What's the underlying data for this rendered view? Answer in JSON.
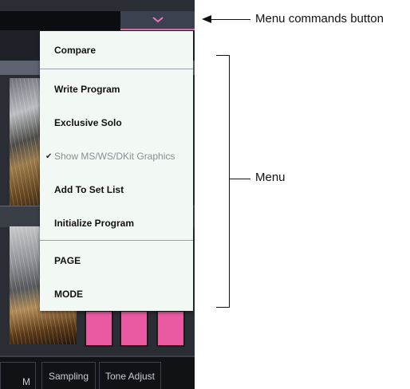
{
  "menu_button": {
    "icon": "chevron-down-icon"
  },
  "menu": {
    "items": [
      {
        "label": "Compare",
        "enabled": true,
        "checked": false
      },
      {
        "label": "Write Program",
        "enabled": true,
        "checked": false
      },
      {
        "label": "Exclusive Solo",
        "enabled": true,
        "checked": false
      },
      {
        "label": "Show MS/WS/DKit Graphics",
        "enabled": false,
        "checked": true
      },
      {
        "label": "Add To Set List",
        "enabled": true,
        "checked": false
      },
      {
        "label": "Initialize Program",
        "enabled": true,
        "checked": false
      },
      {
        "label": "PAGE",
        "enabled": true,
        "checked": false
      },
      {
        "label": "MODE",
        "enabled": true,
        "checked": false
      }
    ],
    "check_mark": "✔"
  },
  "bottom_tabs": [
    "M",
    "Sampling",
    "Tone Adjust"
  ],
  "callouts": {
    "menu_button": "Menu commands button",
    "menu": "Menu"
  },
  "colors": {
    "pad": "#e95aa3",
    "menu_bg": "#f2f8f4",
    "accent": "#d66ca6"
  }
}
